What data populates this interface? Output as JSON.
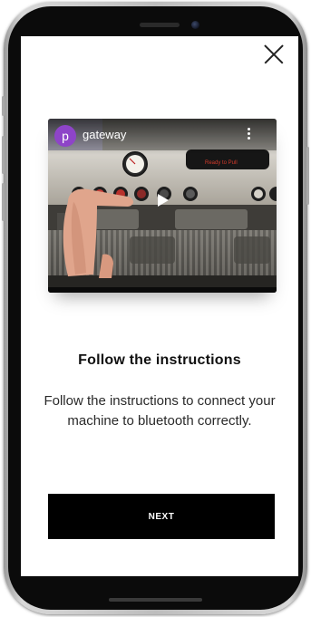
{
  "modal": {
    "close_icon": "close-icon"
  },
  "video": {
    "channel_initial": "p",
    "title": "gateway",
    "display_text": "Ready to Pull",
    "accent_color": "#8e44c8",
    "play_icon": "play-icon",
    "menu_icon": "more-vertical-icon"
  },
  "content": {
    "heading": "Follow the instructions",
    "body": "Follow the instructions to connect your machine to bluetooth correctly."
  },
  "actions": {
    "next_label": "NEXT"
  }
}
